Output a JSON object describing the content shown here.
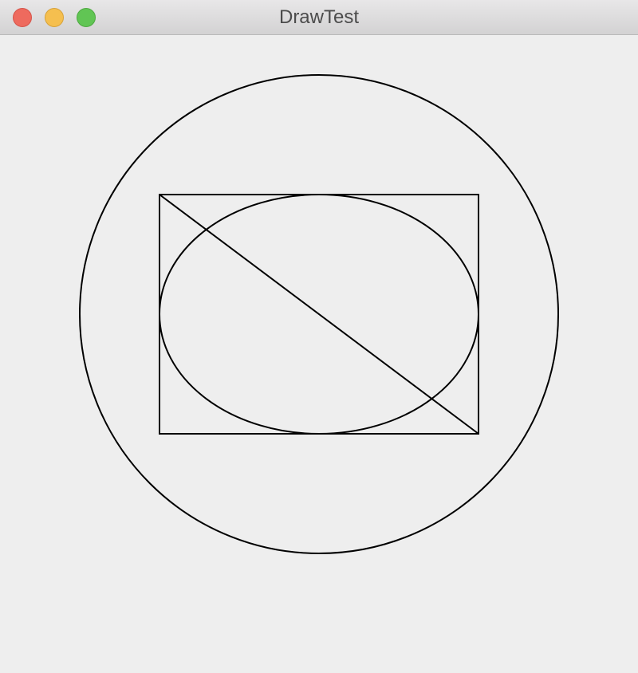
{
  "window": {
    "title": "DrawTest",
    "controls": [
      "close-button",
      "minimize-button",
      "zoom-button"
    ]
  },
  "colors": {
    "background": "#eeeeee",
    "stroke": "#000000",
    "close": "#ee6a5e",
    "minimize": "#f5bf4f",
    "zoom": "#61c554"
  },
  "drawing": {
    "shapes": [
      "rectangle",
      "ellipse",
      "diagonal-line",
      "circle"
    ]
  }
}
